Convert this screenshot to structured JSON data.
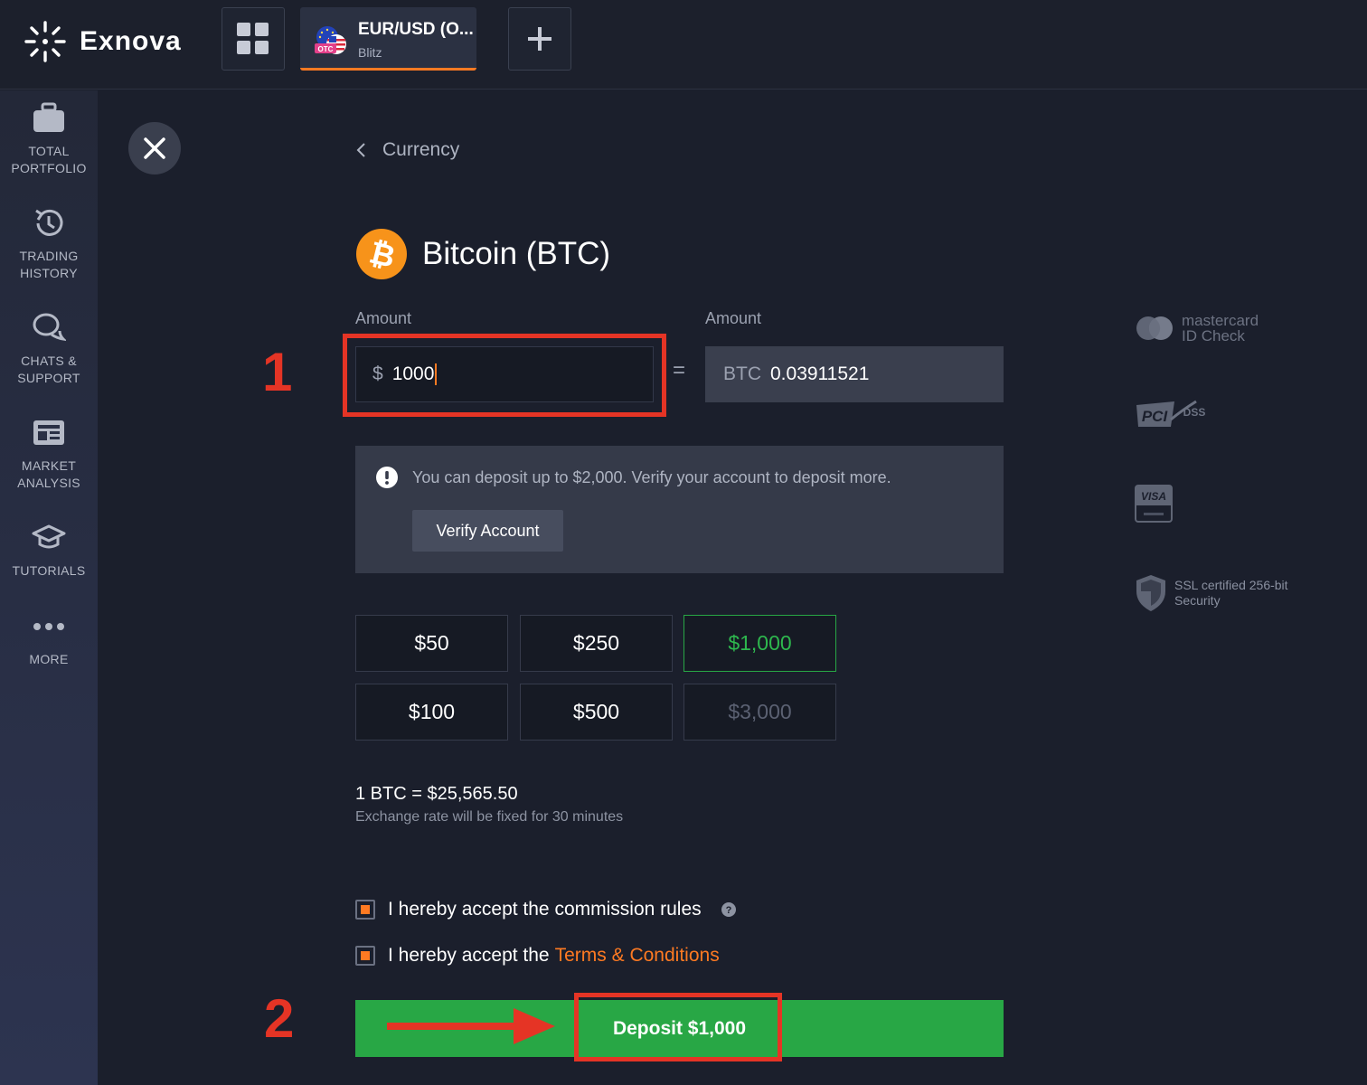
{
  "app": {
    "brand": "Exnova"
  },
  "topbar": {
    "asset_tab": {
      "name": "EUR/USD (O...",
      "subtitle": "Blitz",
      "badge": "OTC"
    }
  },
  "sidebar": {
    "items": [
      {
        "label": "TOTAL\nPORTFOLIO",
        "icon": "briefcase-icon"
      },
      {
        "label": "TRADING\nHISTORY",
        "icon": "history-icon"
      },
      {
        "label": "CHATS &\nSUPPORT",
        "icon": "chat-icon"
      },
      {
        "label": "MARKET\nANALYSIS",
        "icon": "newspaper-icon"
      },
      {
        "label": "TUTORIALS",
        "icon": "graduation-cap-icon"
      },
      {
        "label": "MORE",
        "icon": "more-dots-icon"
      }
    ]
  },
  "main": {
    "back_label": "Currency",
    "coin_title": "Bitcoin (BTC)",
    "amount_label": "Amount",
    "amount_currency_symbol": "$",
    "amount_value": "1000",
    "equals": "=",
    "converted_label": "Amount",
    "converted_currency": "BTC",
    "converted_value": "0.03911521",
    "notice": {
      "text": "You can deposit up to $2,000. Verify your account to deposit more.",
      "button": "Verify Account"
    },
    "presets": [
      "$50",
      "$250",
      "$1,000",
      "$100",
      "$500",
      "$3,000"
    ],
    "selected_preset": "$1,000",
    "disabled_preset": "$3,000",
    "rate": "1 BTC = $25,565.50",
    "rate_note": "Exchange rate will be fixed for 30 minutes",
    "commission_label": "I hereby accept the commission rules",
    "terms_prefix": "I hereby accept the",
    "terms_link": "Terms & Conditions",
    "deposit_button": "Deposit $1,000"
  },
  "annotations": {
    "step1": "1",
    "step2": "2"
  },
  "security": {
    "mastercard": {
      "line1": "mastercard",
      "line2": "ID Check"
    },
    "pci": {
      "text": "PCI",
      "sub": "DSS"
    },
    "visa": "VISA",
    "ssl": {
      "line1": "SSL certified 256-bit",
      "line2": "Security"
    }
  },
  "colors": {
    "accent": "#ff7a22",
    "success": "#28a745",
    "annotation": "#e53425",
    "background": "#1b1f2c"
  }
}
